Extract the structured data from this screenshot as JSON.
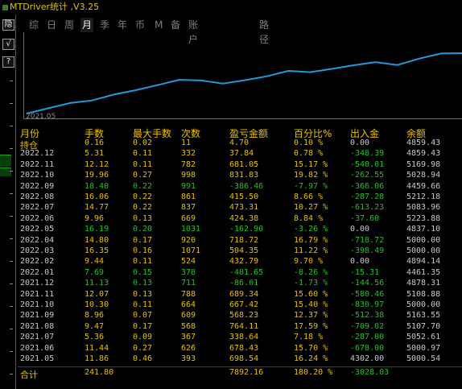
{
  "window_title": "MTDriver统计 ,V3.25",
  "side_buttons": [
    "隐",
    "√",
    "?"
  ],
  "tabs": [
    {
      "label": "综",
      "active": false
    },
    {
      "label": "日",
      "active": false
    },
    {
      "label": "周",
      "active": false
    },
    {
      "label": "月",
      "active": true
    },
    {
      "label": "季",
      "active": false
    },
    {
      "label": "年",
      "active": false
    },
    {
      "label": "币",
      "active": false
    },
    {
      "label": "M",
      "active": false
    },
    {
      "label": "备",
      "active": false
    },
    {
      "label": "账户",
      "active": false
    },
    {
      "label": "路径",
      "active": false
    }
  ],
  "chart_data": {
    "type": "line",
    "x_tick_label": "2021.05",
    "x": [
      "2021.05",
      "2021.06",
      "2021.07",
      "2021.08",
      "2021.09",
      "2021.10",
      "2021.11",
      "2021.12",
      "2022.01",
      "2022.02",
      "2022.03",
      "2022.04",
      "2022.05",
      "2022.06",
      "2022.07",
      "2022.08",
      "2022.09",
      "2022.10",
      "2022.11",
      "2022.12"
    ],
    "series": [
      {
        "values": [
          5000.54,
          5000.97,
          5052.61,
          5107.7,
          5163.55,
          5000.0,
          5108.88,
          4878.31,
          4461.35,
          4894.14,
          5000.0,
          5000.0,
          4837.1,
          5223.88,
          5083.96,
          5212.18,
          4459.66,
          5028.94,
          5169.98,
          4859.43
        ]
      }
    ],
    "line_color": "#1e9bd8",
    "y_range": [
      4400,
      5300
    ]
  },
  "table": {
    "headers": [
      "月份",
      "手数",
      "最大手数",
      "次数",
      "盈亏金额",
      "百分比%",
      "出入金",
      "余额"
    ],
    "colors": {
      "yellow": "#e8c000",
      "gray": "#c8c8c8",
      "green": "#22c222",
      "red": "#e02020",
      "white": "#f0f0f0"
    },
    "rows": [
      {
        "month": "持仓",
        "lots": "0.16",
        "max_lots": "0.02",
        "count": "11",
        "pnl": "4.70",
        "pct": "0.10 %",
        "flow": "0.00",
        "balance": "4859.43",
        "cls": "hold"
      },
      {
        "month": "2022.12",
        "lots": "5.31",
        "max_lots": "0.11",
        "count": "332",
        "pnl": "37.84",
        "pct": "0.78 %",
        "flow": "-348.39",
        "balance": "4859.43",
        "cls": "pos"
      },
      {
        "month": "2022.11",
        "lots": "12.12",
        "max_lots": "0.11",
        "count": "782",
        "pnl": "681.05",
        "pct": "15.17 %",
        "flow": "-540.01",
        "balance": "5169.98",
        "cls": "pos"
      },
      {
        "month": "2022.10",
        "lots": "19.96",
        "max_lots": "0.27",
        "count": "998",
        "pnl": "831.83",
        "pct": "19.82 %",
        "flow": "-262.55",
        "balance": "5028.94",
        "cls": "pos"
      },
      {
        "month": "2022.09",
        "lots": "18.40",
        "max_lots": "0.22",
        "count": "991",
        "pnl": "-386.46",
        "pct": "-7.97 %",
        "flow": "-366.06",
        "balance": "4459.66",
        "cls": "neg"
      },
      {
        "month": "2022.08",
        "lots": "16.06",
        "max_lots": "0.22",
        "count": "861",
        "pnl": "415.50",
        "pct": "8.66 %",
        "flow": "-287.28",
        "balance": "5212.18",
        "cls": "pos"
      },
      {
        "month": "2022.07",
        "lots": "14.77",
        "max_lots": "0.22",
        "count": "837",
        "pnl": "473.31",
        "pct": "10.27 %",
        "flow": "-613.23",
        "balance": "5083.96",
        "cls": "pos"
      },
      {
        "month": "2022.06",
        "lots": "9.96",
        "max_lots": "0.13",
        "count": "669",
        "pnl": "424.38",
        "pct": "8.84 %",
        "flow": "-37.60",
        "balance": "5223.88",
        "cls": "pos"
      },
      {
        "month": "2022.05",
        "lots": "16.19",
        "max_lots": "0.20",
        "count": "1031",
        "pnl": "-162.90",
        "pct": "-3.26 %",
        "flow": "0.00",
        "balance": "4837.10",
        "cls": "neg"
      },
      {
        "month": "2022.04",
        "lots": "14.80",
        "max_lots": "0.17",
        "count": "920",
        "pnl": "718.72",
        "pct": "16.79 %",
        "flow": "-718.72",
        "balance": "5000.00",
        "cls": "pos"
      },
      {
        "month": "2022.03",
        "lots": "16.35",
        "max_lots": "0.16",
        "count": "1071",
        "pnl": "504.35",
        "pct": "11.22 %",
        "flow": "-398.49",
        "balance": "5000.00",
        "cls": "pos"
      },
      {
        "month": "2022.02",
        "lots": "9.44",
        "max_lots": "0.11",
        "count": "524",
        "pnl": "432.79",
        "pct": "9.70 %",
        "flow": "0.00",
        "balance": "4894.14",
        "cls": "pos"
      },
      {
        "month": "2022.01",
        "lots": "7.69",
        "max_lots": "0.15",
        "count": "378",
        "pnl": "-401.65",
        "pct": "-8.26 %",
        "flow": "-15.31",
        "balance": "4461.35",
        "cls": "neg"
      },
      {
        "month": "2021.12",
        "lots": "11.13",
        "max_lots": "0.13",
        "count": "711",
        "pnl": "-86.01",
        "pct": "-1.73 %",
        "flow": "-144.56",
        "balance": "4878.31",
        "cls": "neg"
      },
      {
        "month": "2021.11",
        "lots": "12.07",
        "max_lots": "0.13",
        "count": "788",
        "pnl": "689.34",
        "pct": "15.60 %",
        "flow": "-580.46",
        "balance": "5108.88",
        "cls": "pos"
      },
      {
        "month": "2021.10",
        "lots": "10.30",
        "max_lots": "0.11",
        "count": "664",
        "pnl": "667.42",
        "pct": "15.40 %",
        "flow": "-830.97",
        "balance": "5000.00",
        "cls": "pos"
      },
      {
        "month": "2021.09",
        "lots": "8.96",
        "max_lots": "0.07",
        "count": "609",
        "pnl": "568.23",
        "pct": "12.37 %",
        "flow": "-512.38",
        "balance": "5163.55",
        "cls": "pos"
      },
      {
        "month": "2021.08",
        "lots": "9.47",
        "max_lots": "0.17",
        "count": "568",
        "pnl": "764.11",
        "pct": "17.59 %",
        "flow": "-709.02",
        "balance": "5107.70",
        "cls": "pos"
      },
      {
        "month": "2021.07",
        "lots": "5.36",
        "max_lots": "0.09",
        "count": "367",
        "pnl": "338.64",
        "pct": "7.18 %",
        "flow": "-287.00",
        "balance": "5052.61",
        "cls": "pos"
      },
      {
        "month": "2021.06",
        "lots": "11.44",
        "max_lots": "0.27",
        "count": "626",
        "pnl": "678.43",
        "pct": "15.70 %",
        "flow": "-678.00",
        "balance": "5000.97",
        "cls": "pos"
      },
      {
        "month": "2021.05",
        "lots": "11.86",
        "max_lots": "0.46",
        "count": "393",
        "pnl": "698.54",
        "pct": "16.24 %",
        "flow": "4302.00",
        "balance": "5000.54",
        "cls": "pos"
      }
    ],
    "total": {
      "label": "合计",
      "lots": "241.80",
      "pnl": "7892.16",
      "pct": "180.20 %",
      "flow": "-3028.03"
    }
  }
}
